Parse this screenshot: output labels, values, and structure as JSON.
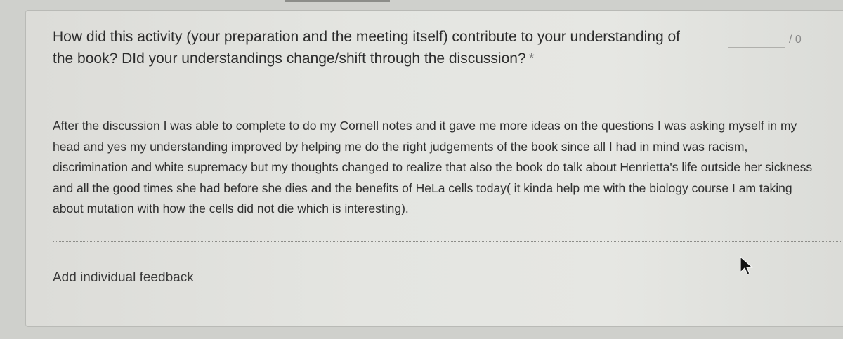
{
  "question": {
    "text": "How did this activity (your preparation and the meeting itself) contribute to your understanding of the book? DId your understandings change/shift through the discussion?",
    "required_marker": "*"
  },
  "points": {
    "value": "",
    "max_label": "/ 0"
  },
  "answer": {
    "text": "After the discussion I was able to complete to do my Cornell notes and it gave me more ideas on the questions I was asking myself in my head and yes my understanding improved by helping me do the right judgements of the book since all I had in mind was racism, discrimination and white supremacy but my thoughts changed to realize that also the book do talk about Henrietta's life outside her sickness and all the good times she had before she dies and the benefits of HeLa cells today( it kinda help me with the biology course I am taking about mutation with how the cells did not die which is interesting)."
  },
  "feedback": {
    "label": "Add individual feedback"
  },
  "icons": {
    "cursor": "mouse-pointer-icon"
  },
  "colors": {
    "background": "#cfd0cc",
    "card": "#e4e5e1",
    "text": "#2c2c2c"
  }
}
